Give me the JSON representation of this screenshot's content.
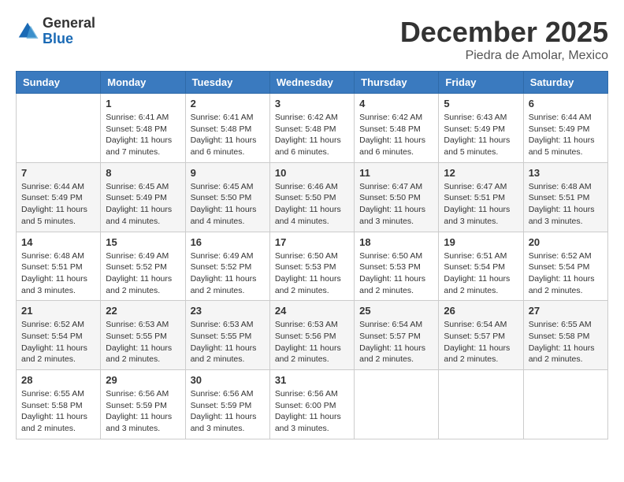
{
  "header": {
    "logo": {
      "general": "General",
      "blue": "Blue"
    },
    "title": "December 2025",
    "location": "Piedra de Amolar, Mexico"
  },
  "calendar": {
    "days_of_week": [
      "Sunday",
      "Monday",
      "Tuesday",
      "Wednesday",
      "Thursday",
      "Friday",
      "Saturday"
    ],
    "weeks": [
      [
        {
          "day": "",
          "info": ""
        },
        {
          "day": "1",
          "info": "Sunrise: 6:41 AM\nSunset: 5:48 PM\nDaylight: 11 hours\nand 7 minutes."
        },
        {
          "day": "2",
          "info": "Sunrise: 6:41 AM\nSunset: 5:48 PM\nDaylight: 11 hours\nand 6 minutes."
        },
        {
          "day": "3",
          "info": "Sunrise: 6:42 AM\nSunset: 5:48 PM\nDaylight: 11 hours\nand 6 minutes."
        },
        {
          "day": "4",
          "info": "Sunrise: 6:42 AM\nSunset: 5:48 PM\nDaylight: 11 hours\nand 6 minutes."
        },
        {
          "day": "5",
          "info": "Sunrise: 6:43 AM\nSunset: 5:49 PM\nDaylight: 11 hours\nand 5 minutes."
        },
        {
          "day": "6",
          "info": "Sunrise: 6:44 AM\nSunset: 5:49 PM\nDaylight: 11 hours\nand 5 minutes."
        }
      ],
      [
        {
          "day": "7",
          "info": "Sunrise: 6:44 AM\nSunset: 5:49 PM\nDaylight: 11 hours\nand 5 minutes."
        },
        {
          "day": "8",
          "info": "Sunrise: 6:45 AM\nSunset: 5:49 PM\nDaylight: 11 hours\nand 4 minutes."
        },
        {
          "day": "9",
          "info": "Sunrise: 6:45 AM\nSunset: 5:50 PM\nDaylight: 11 hours\nand 4 minutes."
        },
        {
          "day": "10",
          "info": "Sunrise: 6:46 AM\nSunset: 5:50 PM\nDaylight: 11 hours\nand 4 minutes."
        },
        {
          "day": "11",
          "info": "Sunrise: 6:47 AM\nSunset: 5:50 PM\nDaylight: 11 hours\nand 3 minutes."
        },
        {
          "day": "12",
          "info": "Sunrise: 6:47 AM\nSunset: 5:51 PM\nDaylight: 11 hours\nand 3 minutes."
        },
        {
          "day": "13",
          "info": "Sunrise: 6:48 AM\nSunset: 5:51 PM\nDaylight: 11 hours\nand 3 minutes."
        }
      ],
      [
        {
          "day": "14",
          "info": "Sunrise: 6:48 AM\nSunset: 5:51 PM\nDaylight: 11 hours\nand 3 minutes."
        },
        {
          "day": "15",
          "info": "Sunrise: 6:49 AM\nSunset: 5:52 PM\nDaylight: 11 hours\nand 2 minutes."
        },
        {
          "day": "16",
          "info": "Sunrise: 6:49 AM\nSunset: 5:52 PM\nDaylight: 11 hours\nand 2 minutes."
        },
        {
          "day": "17",
          "info": "Sunrise: 6:50 AM\nSunset: 5:53 PM\nDaylight: 11 hours\nand 2 minutes."
        },
        {
          "day": "18",
          "info": "Sunrise: 6:50 AM\nSunset: 5:53 PM\nDaylight: 11 hours\nand 2 minutes."
        },
        {
          "day": "19",
          "info": "Sunrise: 6:51 AM\nSunset: 5:54 PM\nDaylight: 11 hours\nand 2 minutes."
        },
        {
          "day": "20",
          "info": "Sunrise: 6:52 AM\nSunset: 5:54 PM\nDaylight: 11 hours\nand 2 minutes."
        }
      ],
      [
        {
          "day": "21",
          "info": "Sunrise: 6:52 AM\nSunset: 5:54 PM\nDaylight: 11 hours\nand 2 minutes."
        },
        {
          "day": "22",
          "info": "Sunrise: 6:53 AM\nSunset: 5:55 PM\nDaylight: 11 hours\nand 2 minutes."
        },
        {
          "day": "23",
          "info": "Sunrise: 6:53 AM\nSunset: 5:55 PM\nDaylight: 11 hours\nand 2 minutes."
        },
        {
          "day": "24",
          "info": "Sunrise: 6:53 AM\nSunset: 5:56 PM\nDaylight: 11 hours\nand 2 minutes."
        },
        {
          "day": "25",
          "info": "Sunrise: 6:54 AM\nSunset: 5:57 PM\nDaylight: 11 hours\nand 2 minutes."
        },
        {
          "day": "26",
          "info": "Sunrise: 6:54 AM\nSunset: 5:57 PM\nDaylight: 11 hours\nand 2 minutes."
        },
        {
          "day": "27",
          "info": "Sunrise: 6:55 AM\nSunset: 5:58 PM\nDaylight: 11 hours\nand 2 minutes."
        }
      ],
      [
        {
          "day": "28",
          "info": "Sunrise: 6:55 AM\nSunset: 5:58 PM\nDaylight: 11 hours\nand 2 minutes."
        },
        {
          "day": "29",
          "info": "Sunrise: 6:56 AM\nSunset: 5:59 PM\nDaylight: 11 hours\nand 3 minutes."
        },
        {
          "day": "30",
          "info": "Sunrise: 6:56 AM\nSunset: 5:59 PM\nDaylight: 11 hours\nand 3 minutes."
        },
        {
          "day": "31",
          "info": "Sunrise: 6:56 AM\nSunset: 6:00 PM\nDaylight: 11 hours\nand 3 minutes."
        },
        {
          "day": "",
          "info": ""
        },
        {
          "day": "",
          "info": ""
        },
        {
          "day": "",
          "info": ""
        }
      ]
    ]
  }
}
